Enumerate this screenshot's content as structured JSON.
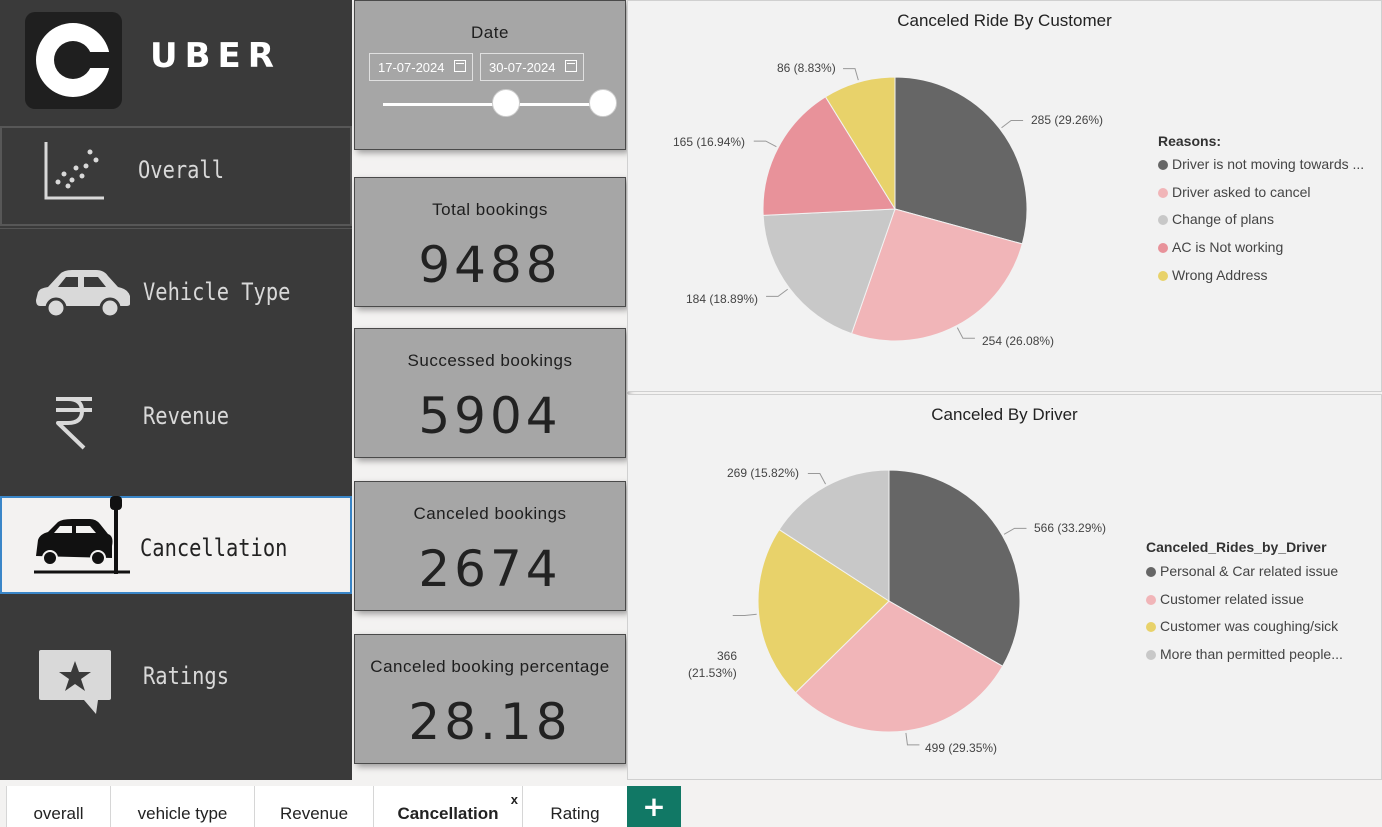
{
  "app": {
    "logo_text": "UBER"
  },
  "sidebar": {
    "items": [
      {
        "label": "Overall",
        "icon": "scatter-chart-icon"
      },
      {
        "label": "Vehicle Type",
        "icon": "car-icon"
      },
      {
        "label": "Revenue",
        "icon": "rupee-icon"
      },
      {
        "label": "Cancellation",
        "icon": "car-crash-icon",
        "active": true
      },
      {
        "label": "Ratings",
        "icon": "star-review-icon"
      }
    ]
  },
  "date_filter": {
    "title": "Date",
    "start": "17-07-2024",
    "end": "30-07-2024"
  },
  "kpis": [
    {
      "title": "Total bookings",
      "value": "9488"
    },
    {
      "title": "Successed bookings",
      "value": "5904"
    },
    {
      "title": "Canceled bookings",
      "value": "2674"
    },
    {
      "title": "Canceled booking percentage",
      "value": "28.18"
    }
  ],
  "chart_data": [
    {
      "type": "pie",
      "title": "Canceled Ride By Customer",
      "legend_title": "Reasons:",
      "legend_position": "right",
      "slices": [
        {
          "name": "Driver is not moving towards ...",
          "value": 285,
          "label": "285 (29.26%)",
          "color": "#666666"
        },
        {
          "name": "Driver asked to cancel",
          "value": 254,
          "label": "254 (26.08%)",
          "color": "#f1b5b8"
        },
        {
          "name": "Change of plans",
          "value": 184,
          "label": "184 (18.89%)",
          "color": "#c8c8c8"
        },
        {
          "name": "AC is Not working",
          "value": 165,
          "label": "165 (16.94%)",
          "color": "#e8929a"
        },
        {
          "name": "Wrong Address",
          "value": 86,
          "label": "86 (8.83%)",
          "color": "#e8d26a"
        }
      ]
    },
    {
      "type": "pie",
      "title": "Canceled By Driver",
      "legend_title": "Canceled_Rides_by_Driver",
      "legend_position": "right",
      "slices": [
        {
          "name": "Personal & Car related issue",
          "value": 566,
          "label": "566 (33.29%)",
          "color": "#666666"
        },
        {
          "name": "Customer related issue",
          "value": 499,
          "label": "499 (29.35%)",
          "color": "#f1b5b8"
        },
        {
          "name": "Customer was coughing/sick",
          "value": 366,
          "label": "366 (21.53%)",
          "label_line1": "366",
          "label_line2": "(21.53%)",
          "color": "#e8d26a"
        },
        {
          "name": "More than permitted people...",
          "value": 269,
          "label": "269 (15.82%)",
          "color": "#c8c8c8"
        }
      ]
    }
  ],
  "tabs": [
    {
      "label": "overall"
    },
    {
      "label": "vehicle type"
    },
    {
      "label": "Revenue"
    },
    {
      "label": "Cancellation",
      "active": true,
      "close": "x"
    },
    {
      "label": "Rating"
    }
  ],
  "add_tab": "+"
}
